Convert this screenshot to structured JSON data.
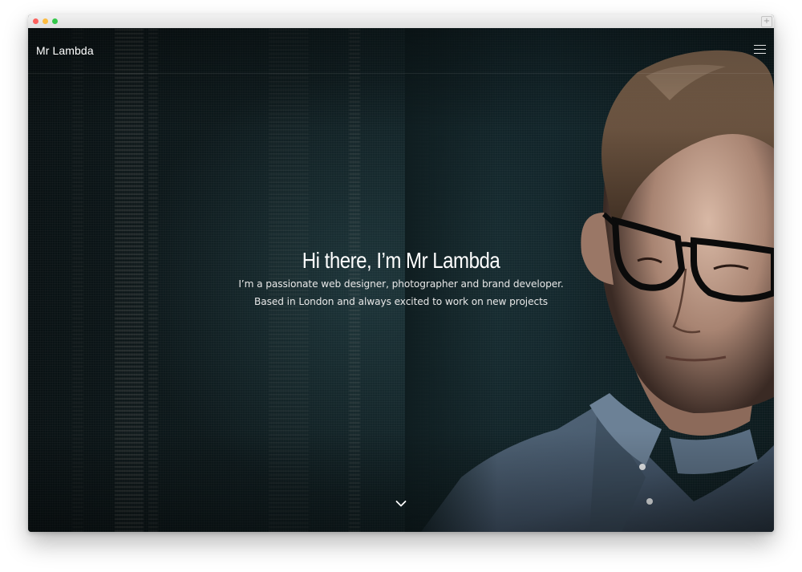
{
  "window": {
    "controls": {
      "close_color": "#fc605c",
      "minimize_color": "#fdbc40",
      "zoom_color": "#34c84a"
    },
    "new_tab_symbol": "+"
  },
  "header": {
    "logo": "Mr Lambda",
    "menu_icon": "hamburger-menu-icon"
  },
  "hero": {
    "title": "Hi there, I’m Mr Lambda",
    "line1": "I’m a passionate web designer, photographer and brand developer.",
    "line2": "Based in London and always excited to work on new projects",
    "scroll_icon": "chevron-down-icon"
  },
  "colors": {
    "background": "#0b1518",
    "text": "#ffffff"
  }
}
